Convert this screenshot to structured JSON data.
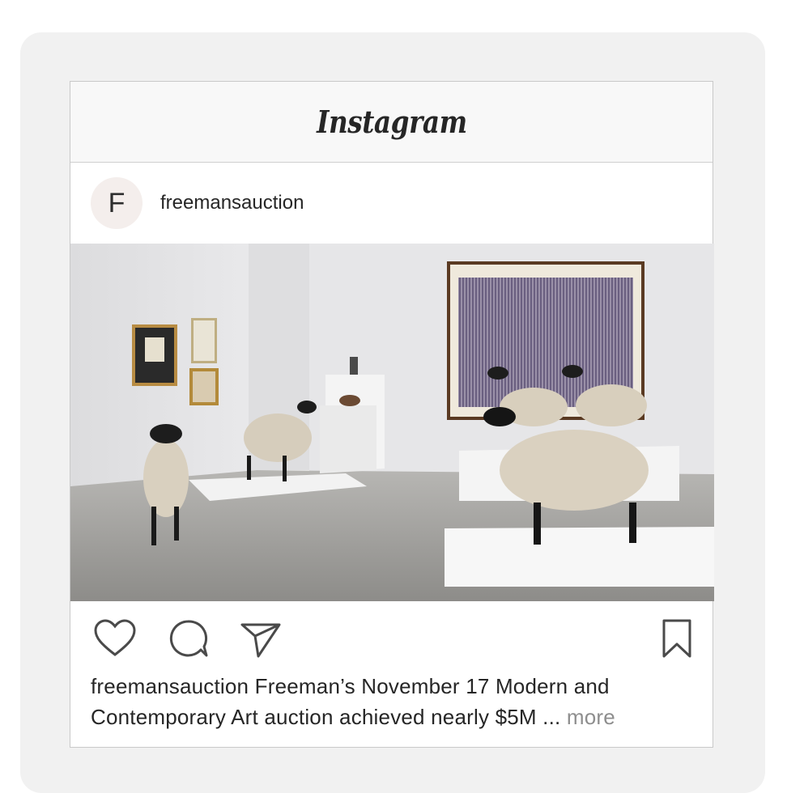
{
  "app": {
    "brand": "Instagram"
  },
  "post": {
    "avatar_letter": "F",
    "username": "freemansauction",
    "image_alt": "Gallery with sheep sculptures",
    "caption_user": "freemansauction",
    "caption_text": "Freeman’s November 17 Modern and Contemporary Art auction achieved nearly $5M ...",
    "more_label": "more"
  },
  "icons": [
    "heart-icon",
    "comment-icon",
    "share-icon",
    "bookmark-icon"
  ],
  "colors": {
    "text": "#262626",
    "muted": "#8e8e8e",
    "border": "#c9c9c9",
    "panel": "#f1f1f1"
  }
}
